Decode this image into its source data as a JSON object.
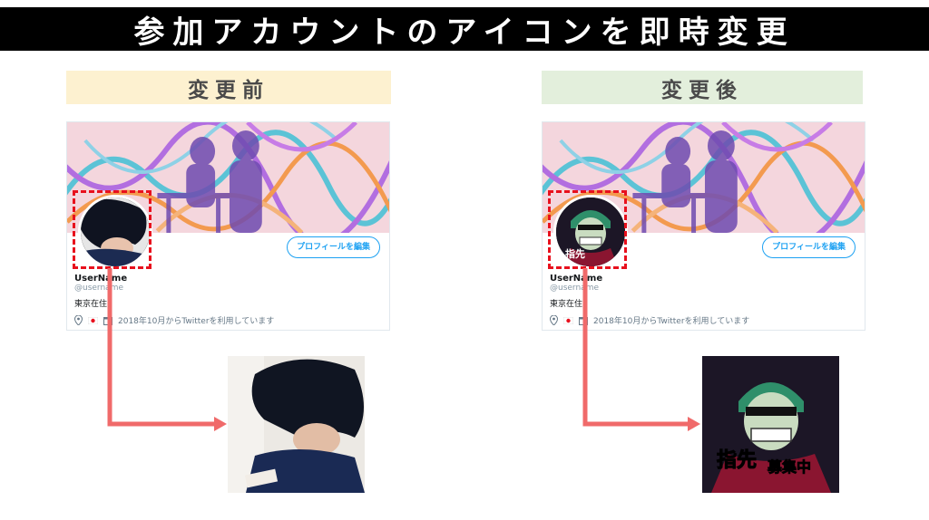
{
  "title": "参加アカウントのアイコンを即時変更",
  "labels": {
    "before": "変更前",
    "after": "変更後"
  },
  "profile": {
    "edit_button": "プロフィールを編集",
    "username": "UserName",
    "handle": "@username",
    "bio": "東京在住",
    "joined": "2018年10月からTwitterを利用しています",
    "icons": [
      "location-pin-icon",
      "japan-flag-icon",
      "calendar-icon"
    ]
  },
  "after_image_text": {
    "main": "指先",
    "sub": "募集中"
  },
  "colors": {
    "title_bg": "#000000",
    "before_bg": "#fdf1d0",
    "after_bg": "#e3efdc",
    "highlight": "#e8101d",
    "arrow": "#f06a6a",
    "accent": "#1da1f2"
  }
}
